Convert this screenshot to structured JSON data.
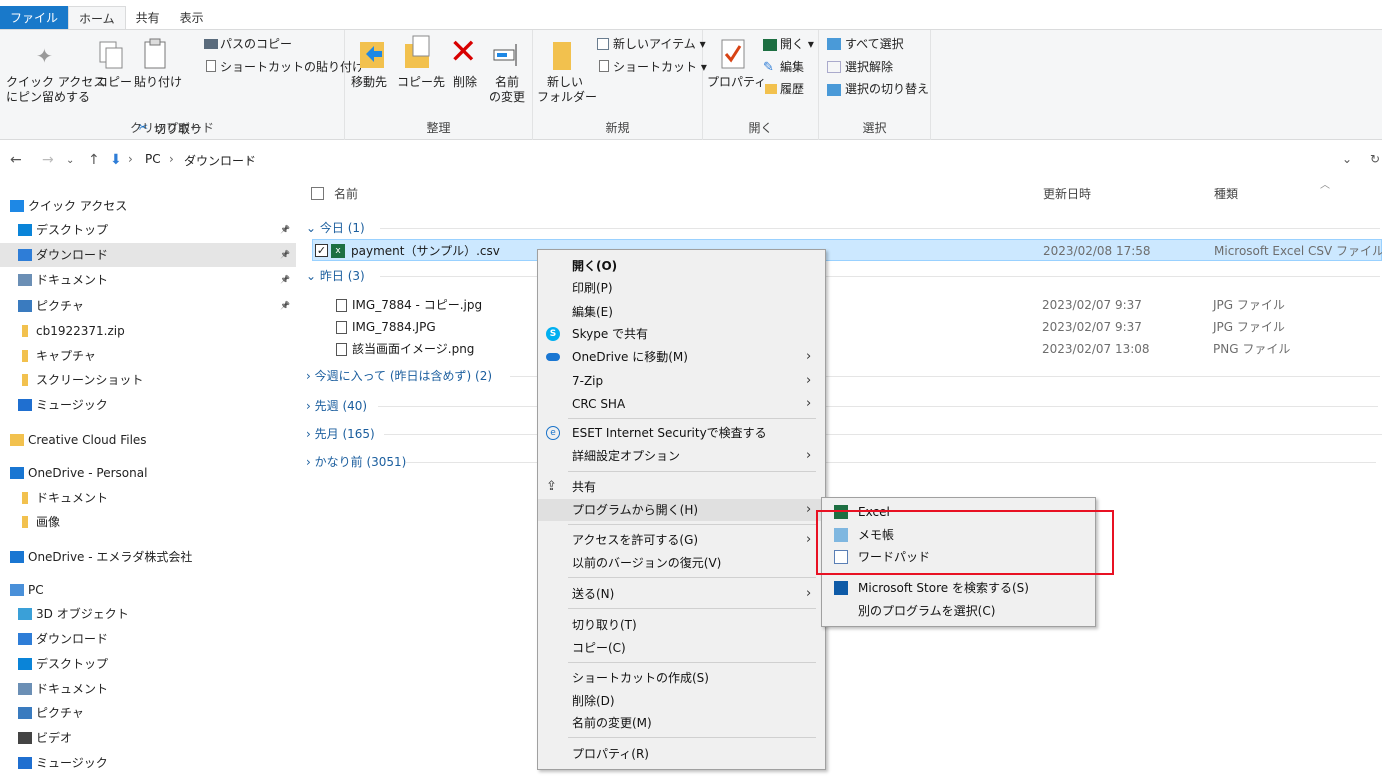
{
  "ribbon_tabs": [
    "ファイル",
    "ホーム",
    "共有",
    "表示"
  ],
  "ribbon": {
    "clipboard": {
      "pin": "クイック アクセス\nにピン留めする",
      "pin_l1": "クイック アクセス",
      "pin_l2": "にピン留めする",
      "copy": "コピー",
      "paste": "貼り付け",
      "copy_path": "パスのコピー",
      "paste_shortcut": "ショートカットの貼り付け",
      "cut": "切り取り",
      "label": "クリップボード"
    },
    "organize": {
      "move_to": "移動先",
      "copy_to": "コピー先",
      "delete": "削除",
      "rename_l1": "名前",
      "rename_l2": "の変更",
      "label": "整理"
    },
    "new": {
      "folder_l1": "新しい",
      "folder_l2": "フォルダー",
      "new_item": "新しいアイテム",
      "shortcut": "ショートカット",
      "label": "新規"
    },
    "open": {
      "properties": "プロパティ",
      "open": "開く",
      "edit": "編集",
      "history": "履歴",
      "label": "開く"
    },
    "select": {
      "select_all": "すべて選択",
      "select_none": "選択解除",
      "invert": "選択の切り替え",
      "label": "選択"
    }
  },
  "address": {
    "crumbs": [
      "PC",
      "ダウンロード"
    ]
  },
  "nav_pane": [
    {
      "label": "クイック アクセス",
      "icon": "star-icon",
      "color": "#1e88e5"
    },
    {
      "label": "デスクトップ",
      "icon": "desktop-icon",
      "color": "#0a84d8",
      "pinned": true
    },
    {
      "label": "ダウンロード",
      "icon": "download-icon",
      "color": "#2e7dd7",
      "pinned": true,
      "selected": true
    },
    {
      "label": "ドキュメント",
      "icon": "document-icon",
      "color": "#6b8fb5",
      "pinned": true
    },
    {
      "label": "ピクチャ",
      "icon": "pictures-icon",
      "color": "#3a7bbf",
      "pinned": true
    },
    {
      "label": "cb1922371.zip",
      "icon": "folder-icon",
      "color": "#f2c14e"
    },
    {
      "label": "キャプチャ",
      "icon": "folder-icon",
      "color": "#f2c14e"
    },
    {
      "label": "スクリーンショット",
      "icon": "folder-icon",
      "color": "#f2c14e"
    },
    {
      "label": "ミュージック",
      "icon": "music-icon",
      "color": "#1f6fd0"
    },
    {
      "label": "Creative Cloud Files",
      "icon": "creative-cloud-icon",
      "color": "#f2c14e"
    },
    {
      "label": "OneDrive - Personal",
      "icon": "onedrive-icon",
      "color": "#1976d2"
    },
    {
      "label": "ドキュメント",
      "icon": "folder-icon",
      "color": "#f2c14e"
    },
    {
      "label": "画像",
      "icon": "folder-icon",
      "color": "#f2c14e"
    },
    {
      "label": "OneDrive - エメラダ株式会社",
      "icon": "onedrive-icon",
      "color": "#1976d2"
    },
    {
      "label": "PC",
      "icon": "pc-icon",
      "color": "#4a90d9"
    },
    {
      "label": "3D オブジェクト",
      "icon": "3d-objects-icon",
      "color": "#3aa0d8"
    },
    {
      "label": "ダウンロード",
      "icon": "download-icon",
      "color": "#2e7dd7"
    },
    {
      "label": "デスクトップ",
      "icon": "desktop-icon",
      "color": "#0a84d8"
    },
    {
      "label": "ドキュメント",
      "icon": "document-icon",
      "color": "#6b8fb5"
    },
    {
      "label": "ピクチャ",
      "icon": "pictures-icon",
      "color": "#3a7bbf"
    },
    {
      "label": "ビデオ",
      "icon": "video-icon",
      "color": "#444"
    },
    {
      "label": "ミュージック",
      "icon": "music-icon",
      "color": "#1f6fd0"
    }
  ],
  "columns": {
    "name": "名前",
    "modified": "更新日時",
    "type": "種類"
  },
  "groups": {
    "today": "今日 (1)",
    "yesterday": "昨日 (3)",
    "this_week": "今週に入って (昨日は含めず) (2)",
    "last_week": "先週 (40)",
    "last_month": "先月 (165)",
    "long_ago": "かなり前 (3051)"
  },
  "files": [
    {
      "name": "payment（サンプル）.csv",
      "modified": "2023/02/08 17:58",
      "type": "Microsoft Excel CSV ファイル"
    },
    {
      "name": "IMG_7884 - コピー.jpg",
      "modified": "2023/02/07 9:37",
      "type": "JPG ファイル"
    },
    {
      "name": "IMG_7884.JPG",
      "modified": "2023/02/07 9:37",
      "type": "JPG ファイル"
    },
    {
      "name": "該当画面イメージ.png",
      "modified": "2023/02/07 13:08",
      "type": "PNG ファイル"
    }
  ],
  "context_menu": {
    "open": "開く(O)",
    "print": "印刷(P)",
    "edit": "編集(E)",
    "skype": "Skype で共有",
    "onedrive": "OneDrive に移動(M)",
    "zip": "7-Zip",
    "crc": "CRC SHA",
    "eset": "ESET Internet Securityで検査する",
    "advanced": "詳細設定オプション",
    "share": "共有",
    "open_with": "プログラムから開く(H)",
    "give_access": "アクセスを許可する(G)",
    "restore": "以前のバージョンの復元(V)",
    "send_to": "送る(N)",
    "cut": "切り取り(T)",
    "copy": "コピー(C)",
    "create_shortcut": "ショートカットの作成(S)",
    "delete": "削除(D)",
    "rename": "名前の変更(M)",
    "properties": "プロパティ(R)"
  },
  "open_with_menu": {
    "excel": "Excel",
    "notepad": "メモ帳",
    "wordpad": "ワードパッド",
    "store": "Microsoft Store を検索する(S)",
    "choose": "別のプログラムを選択(C)"
  },
  "colors": {
    "accent": "#1979ca",
    "highlight": "#e81123",
    "selection": "#cce8ff"
  }
}
